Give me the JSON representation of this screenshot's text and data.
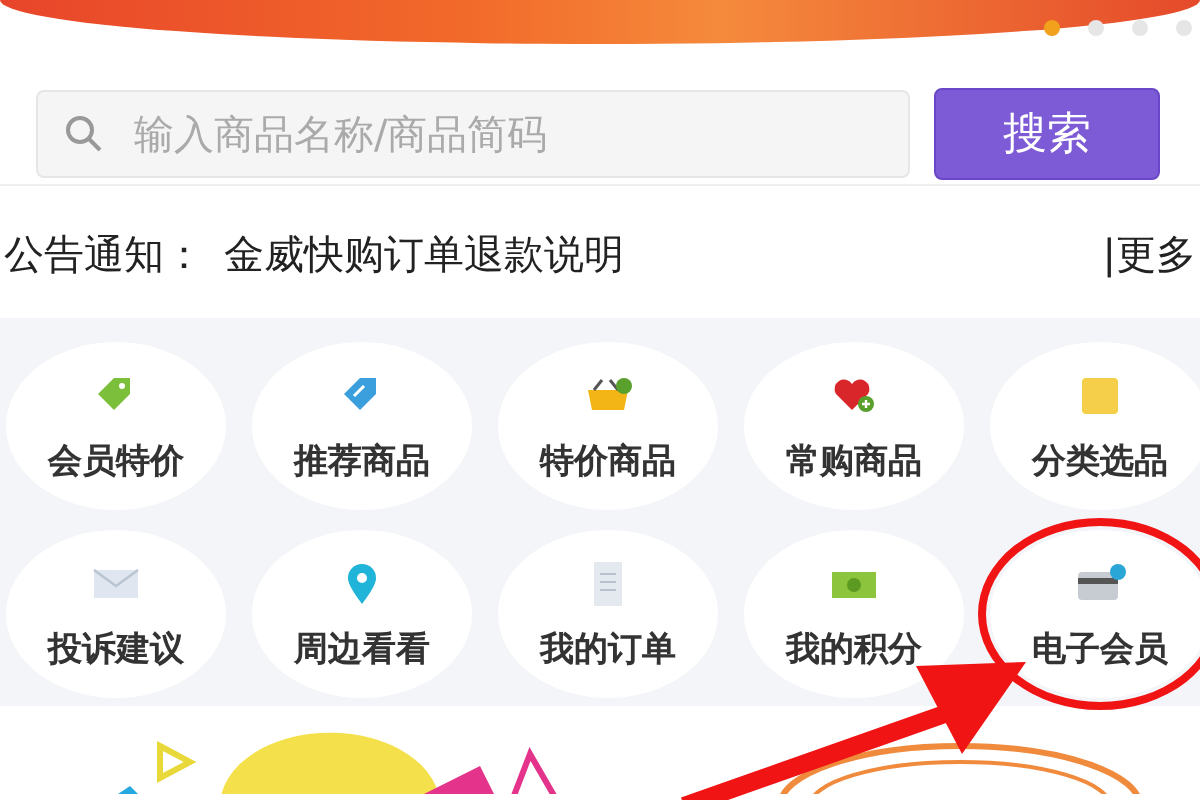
{
  "banner": {
    "dots": [
      {
        "selected": true
      },
      {
        "selected": false
      },
      {
        "selected": false
      },
      {
        "selected": false
      }
    ]
  },
  "search": {
    "placeholder": "输入商品名称/商品简码",
    "button": "搜索"
  },
  "notice": {
    "label": "公告通知：",
    "text": "金威快购订单退款说明",
    "more": "|更多"
  },
  "menu": [
    {
      "label": "会员特价",
      "highlighted": false
    },
    {
      "label": "推荐商品",
      "highlighted": false
    },
    {
      "label": "特价商品",
      "highlighted": false
    },
    {
      "label": "常购商品",
      "highlighted": false
    },
    {
      "label": "分类选品",
      "highlighted": false
    },
    {
      "label": "投诉建议",
      "highlighted": false
    },
    {
      "label": "周边看看",
      "highlighted": false
    },
    {
      "label": "我的订单",
      "highlighted": false
    },
    {
      "label": "我的积分",
      "highlighted": false
    },
    {
      "label": "电子会员",
      "highlighted": true
    }
  ]
}
